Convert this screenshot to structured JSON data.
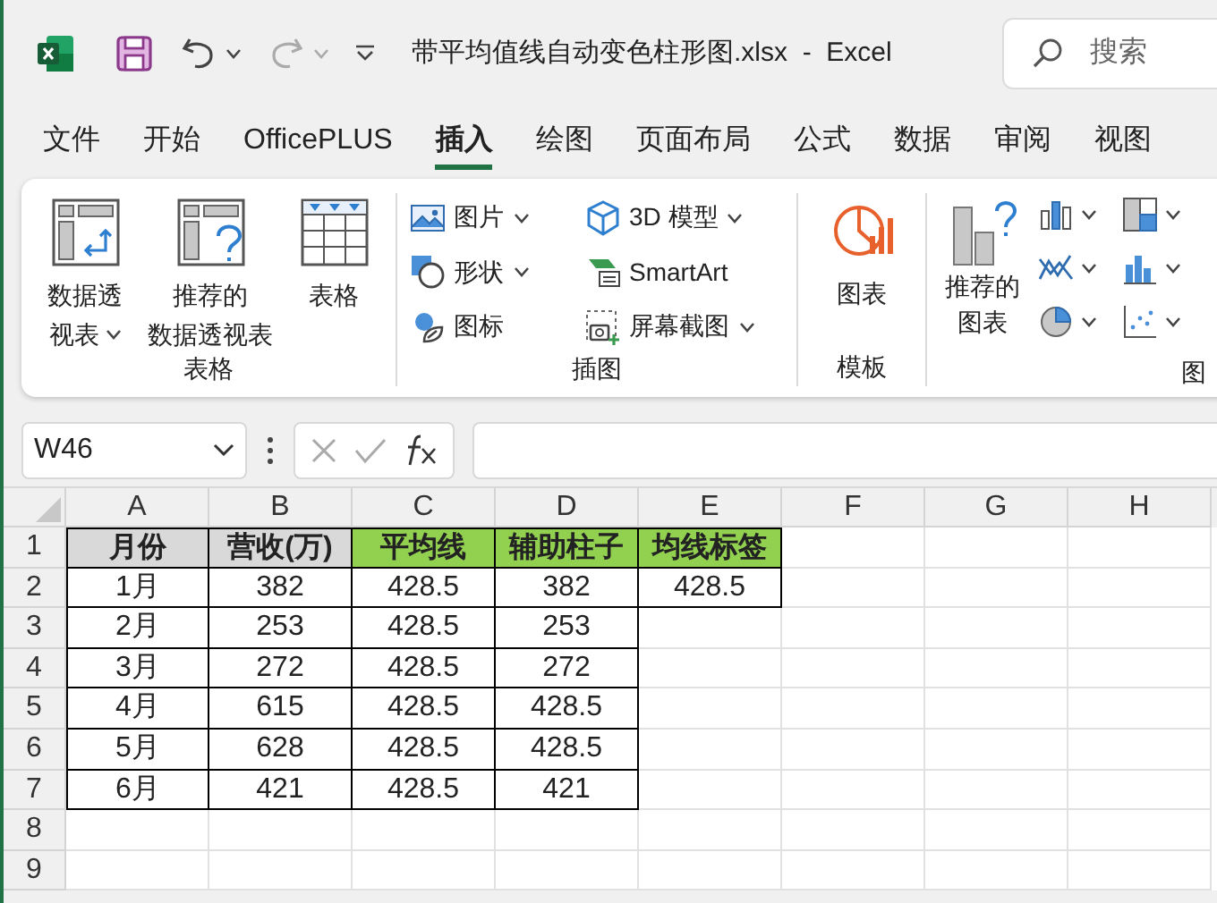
{
  "title_bar": {
    "file_name": "带平均值线自动变色柱形图.xlsx  -  Excel",
    "search": {
      "placeholder": "搜索"
    }
  },
  "menu_tabs": [
    {
      "label": "文件",
      "selected": false
    },
    {
      "label": "开始",
      "selected": false
    },
    {
      "label": "OfficePLUS",
      "selected": false
    },
    {
      "label": "插入",
      "selected": true
    },
    {
      "label": "绘图",
      "selected": false
    },
    {
      "label": "页面布局",
      "selected": false
    },
    {
      "label": "公式",
      "selected": false
    },
    {
      "label": "数据",
      "selected": false
    },
    {
      "label": "审阅",
      "selected": false
    },
    {
      "label": "视图",
      "selected": false
    }
  ],
  "ribbon": {
    "table_group": {
      "label": "表格",
      "buttons": [
        {
          "lines": [
            "数据透",
            "视表"
          ],
          "dropdown": true
        },
        {
          "lines": [
            "推荐的",
            "数据透视表"
          ],
          "dropdown": false
        },
        {
          "lines": [
            "表格"
          ],
          "dropdown": false
        }
      ]
    },
    "illustrations_group": {
      "label": "插图",
      "buttons": [
        {
          "label": "图片",
          "dropdown": true
        },
        {
          "label": "形状",
          "dropdown": true
        },
        {
          "label": "图标",
          "dropdown": false
        },
        {
          "label": "3D 模型",
          "dropdown": true
        },
        {
          "label": "SmartArt",
          "dropdown": false
        },
        {
          "label": "屏幕截图",
          "dropdown": true
        }
      ]
    },
    "template_group": {
      "label": "模板",
      "button": "图表"
    },
    "charts_group": {
      "label": "图",
      "button_lines": [
        "推荐的",
        "图表"
      ]
    }
  },
  "name_box": "W46",
  "sheet": {
    "columns": [
      "A",
      "B",
      "C",
      "D",
      "E",
      "F",
      "G",
      "H"
    ],
    "rows": [
      {
        "header": "1",
        "cells": [
          {
            "text": "月份",
            "kind": "header",
            "color": "#d9d9d9"
          },
          {
            "text": "营收(万)",
            "kind": "header",
            "color": "#d9d9d9"
          },
          {
            "text": "平均线",
            "kind": "header",
            "color": "#92d050"
          },
          {
            "text": "辅助柱子",
            "kind": "header",
            "color": "#92d050"
          },
          {
            "text": "均线标签",
            "kind": "header",
            "color": "#92d050"
          }
        ]
      },
      {
        "header": "2",
        "cells": [
          {
            "text": "1月",
            "kind": "data"
          },
          {
            "text": "382",
            "kind": "data"
          },
          {
            "text": "428.5",
            "kind": "data"
          },
          {
            "text": "382",
            "kind": "data"
          },
          {
            "text": "428.5",
            "kind": "data"
          }
        ]
      },
      {
        "header": "3",
        "cells": [
          {
            "text": "2月",
            "kind": "data"
          },
          {
            "text": "253",
            "kind": "data"
          },
          {
            "text": "428.5",
            "kind": "data"
          },
          {
            "text": "253",
            "kind": "data"
          }
        ]
      },
      {
        "header": "4",
        "cells": [
          {
            "text": "3月",
            "kind": "data"
          },
          {
            "text": "272",
            "kind": "data"
          },
          {
            "text": "428.5",
            "kind": "data"
          },
          {
            "text": "272",
            "kind": "data"
          }
        ]
      },
      {
        "header": "5",
        "cells": [
          {
            "text": "4月",
            "kind": "data"
          },
          {
            "text": "615",
            "kind": "data"
          },
          {
            "text": "428.5",
            "kind": "data"
          },
          {
            "text": "428.5",
            "kind": "data"
          }
        ]
      },
      {
        "header": "6",
        "cells": [
          {
            "text": "5月",
            "kind": "data"
          },
          {
            "text": "628",
            "kind": "data"
          },
          {
            "text": "428.5",
            "kind": "data"
          },
          {
            "text": "428.5",
            "kind": "data"
          }
        ]
      },
      {
        "header": "7",
        "cells": [
          {
            "text": "6月",
            "kind": "data"
          },
          {
            "text": "421",
            "kind": "data"
          },
          {
            "text": "428.5",
            "kind": "data"
          },
          {
            "text": "421",
            "kind": "data"
          }
        ]
      },
      {
        "header": "8",
        "cells": []
      },
      {
        "header": "9",
        "cells": []
      }
    ]
  }
}
